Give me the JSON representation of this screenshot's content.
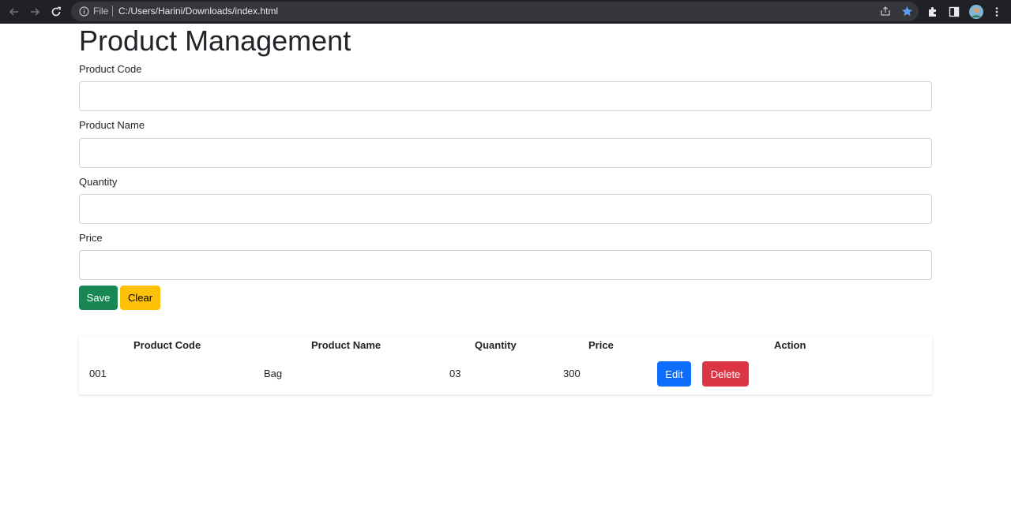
{
  "browser": {
    "file_label": "File",
    "url": "C:/Users/Harini/Downloads/index.html"
  },
  "page": {
    "title": "Product Management"
  },
  "form": {
    "fields": [
      {
        "label": "Product Code",
        "value": ""
      },
      {
        "label": "Product Name",
        "value": ""
      },
      {
        "label": "Quantity",
        "value": ""
      },
      {
        "label": "Price",
        "value": ""
      }
    ],
    "save_label": "Save",
    "clear_label": "Clear"
  },
  "table": {
    "headers": [
      "Product Code",
      "Product Name",
      "Quantity",
      "Price",
      "Action"
    ],
    "rows": [
      {
        "code": "001",
        "name": "Bag",
        "quantity": "03",
        "price": "300",
        "edit_label": "Edit",
        "delete_label": "Delete"
      }
    ]
  },
  "colors": {
    "save": "#198754",
    "clear": "#ffc107",
    "edit": "#0d6efd",
    "delete": "#dc3545",
    "bookmark_star": "#5b9cf6"
  }
}
